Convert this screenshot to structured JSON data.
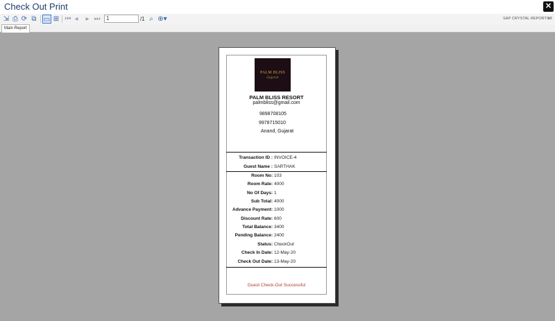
{
  "window": {
    "title": "Check Out Print",
    "close_glyph": "✕"
  },
  "toolbar": {
    "page_input": "1",
    "page_total": "/1",
    "brand": "SAP CRYSTAL REPORTS®"
  },
  "tabs": [
    {
      "label": "Main Report"
    }
  ],
  "report": {
    "logo_line1": "PALM BLISS",
    "logo_line2": "Gujarat",
    "hotel_name": "PALM BLISS RESORT",
    "email": "palmbliss@gmail.com",
    "phone1": "9898708105",
    "phone2": "9978715010",
    "address": "Anand, Gujarat",
    "header_fields": [
      {
        "label": "Transaction ID :",
        "value": "INVOICE-4"
      },
      {
        "label": "Guest Name :",
        "value": "SARTHAK"
      }
    ],
    "fields": [
      {
        "label": "Room No",
        "value": "103"
      },
      {
        "label": "Room Rate",
        "value": "4000"
      },
      {
        "label": "No Of Days",
        "value": "1"
      },
      {
        "label": "Sub Total",
        "value": "4000"
      },
      {
        "label": "Advance Payment",
        "value": "1000"
      },
      {
        "label": "Discount Rate",
        "value": "600"
      },
      {
        "label": "Total Balance",
        "value": "3400"
      },
      {
        "label": "Pending Balance",
        "value": "2400"
      },
      {
        "label": "Status",
        "value": "CheckOut"
      },
      {
        "label": "Check In Date",
        "value": "12-May-20"
      },
      {
        "label": "Check Out Date",
        "value": "13-May-20"
      }
    ],
    "colon": ":",
    "success_message": "Guest Check-Out Successful"
  }
}
